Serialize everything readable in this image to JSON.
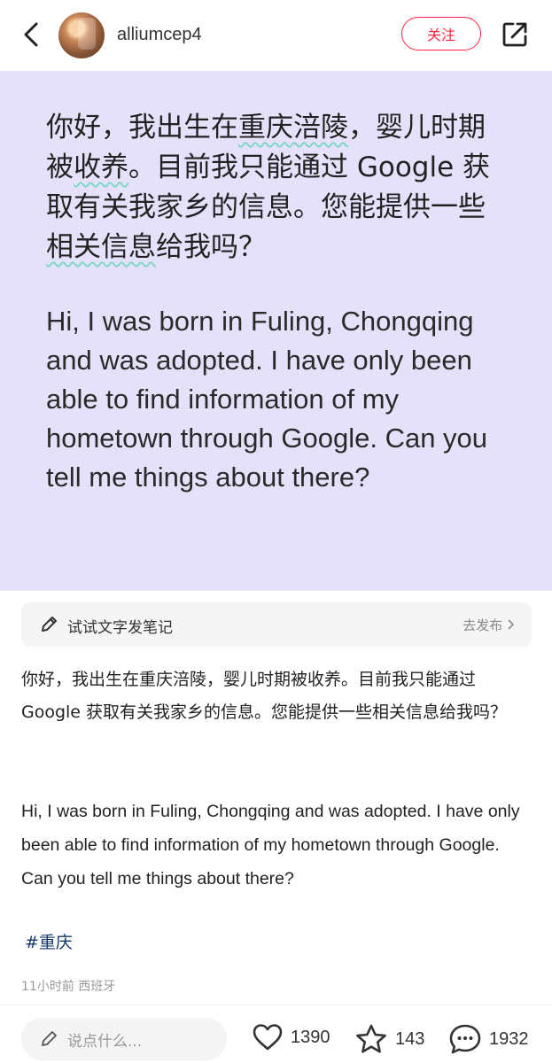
{
  "header": {
    "username": "alliumcep4",
    "follow_label": "关注"
  },
  "hero": {
    "cn_segments": [
      "你好，我出生在",
      "重庆涪陵",
      "，婴儿时期被",
      "收养",
      "。目前我只能通过 Google 获取有关我家乡的信息。您能提供一些",
      "相关信息",
      "给我吗？"
    ],
    "en_text": "Hi, I was born in Fuling, Chongqing and was adopted. I have only been able to find information of my hometown through Google. Can you tell me things about there?"
  },
  "draft": {
    "label": "试试文字发笔记",
    "action": "去发布"
  },
  "post": {
    "body_cn": "你好，我出生在重庆涪陵，婴儿时期被收养。目前我只能通过 Google 获取有关我家乡的信息。您能提供一些相关信息给我吗？",
    "body_en": "Hi, I was born in Fuling, Chongqing and was adopted. I have only been able to find information of my hometown through Google. Can you tell me things about there?",
    "hashtag": "#重庆",
    "meta": "11小时前 西班牙"
  },
  "bottom": {
    "comment_placeholder": "说点什么...",
    "likes": "1390",
    "stars": "143",
    "comments": "1932"
  },
  "colors": {
    "accent": "#ff2442",
    "hero_bg": "#e5e1fa",
    "wave_underline": "#7fd8c7",
    "hashtag": "#13386c"
  },
  "icons": [
    "back-chevron-icon",
    "share-icon",
    "pen-icon",
    "chevron-right-icon",
    "heart-icon",
    "star-icon",
    "comment-bubble-icon"
  ]
}
